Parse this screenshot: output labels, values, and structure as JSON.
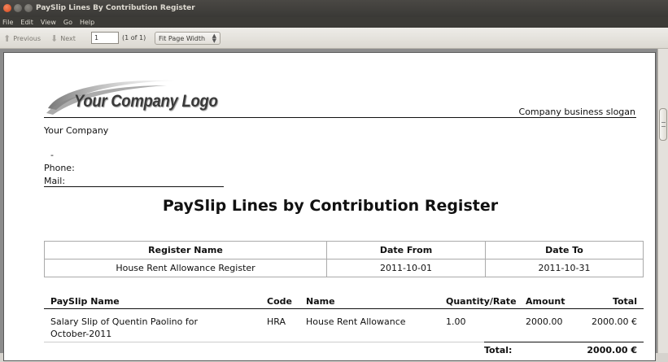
{
  "window": {
    "title": "PaySlip Lines By Contribution Register"
  },
  "menu": [
    "File",
    "Edit",
    "View",
    "Go",
    "Help"
  ],
  "toolbar": {
    "previous_label": "Previous",
    "next_label": "Next",
    "page_value": "1",
    "page_count": "(1 of 1)",
    "zoom_value": "Fit Page Width"
  },
  "doc": {
    "logo_text": "Your Company Logo",
    "slogan": "Company business slogan",
    "company_name": "Your Company",
    "address_dash": "-",
    "phone_label": "Phone:",
    "mail_label": "Mail:",
    "title": "PaySlip Lines by Contribution Register",
    "register_table": {
      "headers": [
        "Register Name",
        "Date From",
        "Date To"
      ],
      "row": [
        "House Rent Allowance Register",
        "2011-10-01",
        "2011-10-31"
      ]
    },
    "lines": {
      "headers": {
        "payslip_name": "PaySlip Name",
        "code": "Code",
        "name": "Name",
        "quantity": "Quantity/Rate",
        "amount": "Amount",
        "total": "Total"
      },
      "rows": [
        {
          "payslip_name_1": "Salary Slip of Quentin Paolino for",
          "payslip_name_2": "October-2011",
          "code": "HRA",
          "name": "House Rent Allowance",
          "quantity": "1.00",
          "amount": "2000.00",
          "total": "2000.00 €"
        }
      ],
      "total_label": "Total:",
      "total_value": "2000.00 €"
    }
  }
}
